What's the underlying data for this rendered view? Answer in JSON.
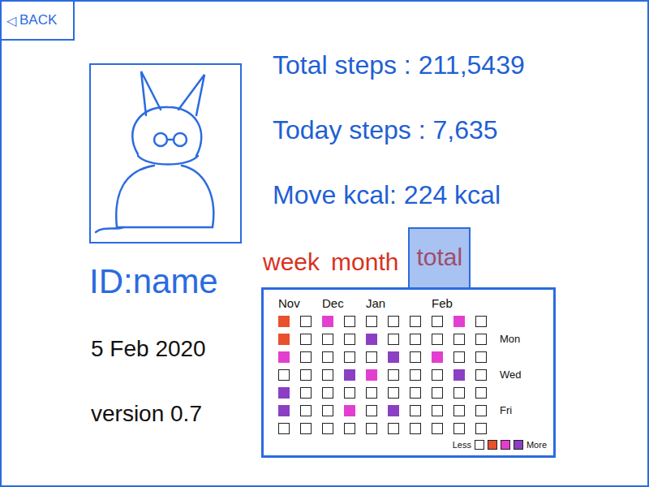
{
  "back": {
    "icon": "◁",
    "label": "BACK"
  },
  "profile": {
    "id_label": "ID:name",
    "date": "5 Feb 2020",
    "version": "version 0.7"
  },
  "stats": [
    "Total steps : 211,5439",
    "Today steps : 7,635",
    "Move kcal:  224 kcal"
  ],
  "tabs": [
    {
      "label": "week",
      "selected": false
    },
    {
      "label": "month",
      "selected": false
    },
    {
      "label": "total",
      "selected": true
    }
  ],
  "heatmap": {
    "day_labels": [
      "",
      "Mon",
      "",
      "Wed",
      "",
      "Fri",
      ""
    ],
    "weeks": [
      {
        "month": "Nov",
        "days": [
          {
            "filled": true,
            "color": "#e8502e"
          },
          {
            "filled": true,
            "color": "#e8502e"
          },
          {
            "filled": true,
            "color": "#e33fcf"
          },
          {
            "filled": false,
            "color": "#ffffff"
          },
          {
            "filled": true,
            "color": "#8b3fc2"
          },
          {
            "filled": true,
            "color": "#8b3fc2"
          },
          {
            "filled": false,
            "color": "#ffffff"
          }
        ]
      },
      {
        "month": "",
        "days": [
          {
            "filled": false,
            "color": "#ffffff"
          },
          {
            "filled": false,
            "color": "#ffffff"
          },
          {
            "filled": false,
            "color": "#ffffff"
          },
          {
            "filled": false,
            "color": "#ffffff"
          },
          {
            "filled": false,
            "color": "#ffffff"
          },
          {
            "filled": false,
            "color": "#ffffff"
          },
          {
            "filled": false,
            "color": "#ffffff"
          }
        ]
      },
      {
        "month": "Dec",
        "days": [
          {
            "filled": true,
            "color": "#e33fcf"
          },
          {
            "filled": false,
            "color": "#ffffff"
          },
          {
            "filled": false,
            "color": "#ffffff"
          },
          {
            "filled": false,
            "color": "#ffffff"
          },
          {
            "filled": false,
            "color": "#ffffff"
          },
          {
            "filled": false,
            "color": "#ffffff"
          },
          {
            "filled": false,
            "color": "#ffffff"
          }
        ]
      },
      {
        "month": "",
        "days": [
          {
            "filled": false,
            "color": "#ffffff"
          },
          {
            "filled": false,
            "color": "#ffffff"
          },
          {
            "filled": false,
            "color": "#ffffff"
          },
          {
            "filled": true,
            "color": "#8b3fc2"
          },
          {
            "filled": false,
            "color": "#ffffff"
          },
          {
            "filled": true,
            "color": "#e33fcf"
          },
          {
            "filled": false,
            "color": "#ffffff"
          }
        ]
      },
      {
        "month": "Jan",
        "days": [
          {
            "filled": false,
            "color": "#ffffff"
          },
          {
            "filled": true,
            "color": "#8b3fc2"
          },
          {
            "filled": false,
            "color": "#ffffff"
          },
          {
            "filled": true,
            "color": "#e33fcf"
          },
          {
            "filled": false,
            "color": "#ffffff"
          },
          {
            "filled": false,
            "color": "#ffffff"
          },
          {
            "filled": false,
            "color": "#ffffff"
          }
        ]
      },
      {
        "month": "",
        "days": [
          {
            "filled": false,
            "color": "#ffffff"
          },
          {
            "filled": false,
            "color": "#ffffff"
          },
          {
            "filled": true,
            "color": "#8b3fc2"
          },
          {
            "filled": false,
            "color": "#ffffff"
          },
          {
            "filled": false,
            "color": "#ffffff"
          },
          {
            "filled": true,
            "color": "#8b3fc2"
          },
          {
            "filled": false,
            "color": "#ffffff"
          }
        ]
      },
      {
        "month": "",
        "days": [
          {
            "filled": false,
            "color": "#ffffff"
          },
          {
            "filled": false,
            "color": "#ffffff"
          },
          {
            "filled": false,
            "color": "#ffffff"
          },
          {
            "filled": false,
            "color": "#ffffff"
          },
          {
            "filled": false,
            "color": "#ffffff"
          },
          {
            "filled": false,
            "color": "#ffffff"
          },
          {
            "filled": false,
            "color": "#ffffff"
          }
        ]
      },
      {
        "month": "Feb",
        "days": [
          {
            "filled": false,
            "color": "#ffffff"
          },
          {
            "filled": false,
            "color": "#ffffff"
          },
          {
            "filled": true,
            "color": "#e33fcf"
          },
          {
            "filled": false,
            "color": "#ffffff"
          },
          {
            "filled": false,
            "color": "#ffffff"
          },
          {
            "filled": false,
            "color": "#ffffff"
          },
          {
            "filled": false,
            "color": "#ffffff"
          }
        ]
      },
      {
        "month": "",
        "days": [
          {
            "filled": true,
            "color": "#e33fcf"
          },
          {
            "filled": false,
            "color": "#ffffff"
          },
          {
            "filled": false,
            "color": "#ffffff"
          },
          {
            "filled": true,
            "color": "#8b3fc2"
          },
          {
            "filled": false,
            "color": "#ffffff"
          },
          {
            "filled": false,
            "color": "#ffffff"
          },
          {
            "filled": false,
            "color": "#ffffff"
          }
        ]
      },
      {
        "month": "",
        "days": [
          {
            "filled": false,
            "color": "#ffffff"
          },
          {
            "filled": false,
            "color": "#ffffff"
          },
          {
            "filled": false,
            "color": "#ffffff"
          },
          {
            "filled": false,
            "color": "#ffffff"
          },
          {
            "filled": false,
            "color": "#ffffff"
          },
          {
            "filled": false,
            "color": "#ffffff"
          },
          {
            "filled": false,
            "color": "#ffffff"
          }
        ]
      }
    ],
    "legend": {
      "less": "Less",
      "more": "More",
      "colors": [
        "#ffffff",
        "#e8502e",
        "#e33fcf",
        "#8b3fc2"
      ]
    }
  }
}
